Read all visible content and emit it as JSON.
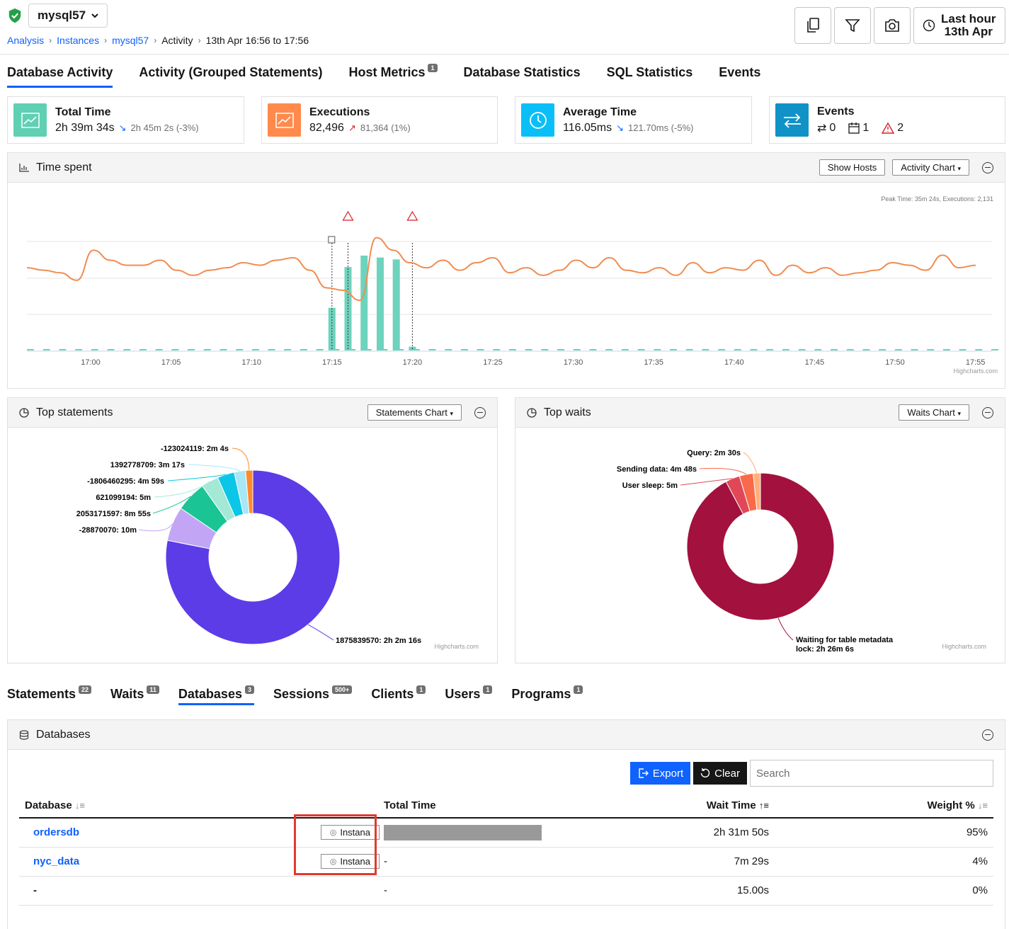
{
  "header": {
    "instance_name": "mysql57",
    "breadcrumb": [
      "Analysis",
      "Instances",
      "mysql57",
      "Activity",
      "13th Apr 16:56 to 17:56"
    ],
    "time_range_line1": "Last hour",
    "time_range_line2": "13th Apr"
  },
  "tabs": [
    {
      "label": "Database Activity",
      "active": true
    },
    {
      "label": "Activity (Grouped Statements)"
    },
    {
      "label": "Host Metrics",
      "badge": "1"
    },
    {
      "label": "Database Statistics"
    },
    {
      "label": "SQL Statistics"
    },
    {
      "label": "Events"
    }
  ],
  "kpis": {
    "total_time": {
      "title": "Total Time",
      "value": "2h 39m 34s",
      "compare": "2h 45m 2s (-3%)",
      "color": "#5fd0b3"
    },
    "executions": {
      "title": "Executions",
      "value": "82,496",
      "compare": "81,364 (1%)",
      "color": "#ff8a4c"
    },
    "average_time": {
      "title": "Average Time",
      "value": "116.05ms",
      "compare": "121.70ms (-5%)",
      "color": "#0abff7"
    },
    "events": {
      "title": "Events",
      "transfers": "0",
      "calendar": "1",
      "alerts": "2",
      "color": "#1192c7"
    }
  },
  "time_spent": {
    "title": "Time spent",
    "show_hosts": "Show Hosts",
    "chart_menu": "Activity Chart",
    "peak": "Peak Time: 35m 24s, Executions: 2,131",
    "credit": "Highcharts.com"
  },
  "top_statements": {
    "title": "Top statements",
    "chart_menu": "Statements Chart",
    "credit": "Highcharts.com"
  },
  "top_waits": {
    "title": "Top waits",
    "chart_menu": "Waits Chart",
    "credit": "Highcharts.com"
  },
  "chart_data": [
    {
      "type": "line",
      "title": "Time spent",
      "x_ticks": [
        "17:00",
        "17:05",
        "17:10",
        "17:15",
        "17:20",
        "17:25",
        "17:30",
        "17:35",
        "17:40",
        "17:45",
        "17:50",
        "17:55"
      ],
      "bars": [
        {
          "x": "17:15",
          "value": 0.45
        },
        {
          "x": "17:16",
          "value": 0.88
        },
        {
          "x": "17:17",
          "value": 1.0
        },
        {
          "x": "17:18",
          "value": 0.98
        },
        {
          "x": "17:19",
          "value": 0.96
        },
        {
          "x": "17:20",
          "value": 0.04
        }
      ],
      "bar_color": "#6dd3bd",
      "line_color": "#f08c51",
      "line_series": [
        0.66,
        0.64,
        0.62,
        0.56,
        0.8,
        0.72,
        0.68,
        0.68,
        0.72,
        0.64,
        0.6,
        0.64,
        0.66,
        0.7,
        0.68,
        0.72,
        0.74,
        0.64,
        0.5,
        0.48,
        0.4,
        0.9,
        0.8,
        0.7,
        0.66,
        0.72,
        0.64,
        0.7,
        0.74,
        0.62,
        0.66,
        0.6,
        0.64,
        0.72,
        0.66,
        0.74,
        0.64,
        0.62,
        0.66,
        0.6,
        0.7,
        0.62,
        0.66,
        0.64,
        0.72,
        0.6,
        0.68,
        0.62,
        0.66,
        0.6,
        0.62,
        0.64,
        0.7,
        0.68,
        0.64,
        0.76,
        0.66,
        0.68
      ],
      "markers": [
        "17:15",
        "17:16",
        "17:20"
      ]
    },
    {
      "type": "pie",
      "title": "Top statements",
      "labels": [
        "1875839570: 2h 2m 16s",
        "-28870070: 10m",
        "2053171597: 8m 55s",
        "621099194: 5m",
        "-1806460295: 4m 59s",
        "1392778709: 3m 17s",
        "-123024119: 2m 4s"
      ],
      "values": [
        7336,
        600,
        535,
        300,
        299,
        197,
        124
      ],
      "colors": [
        "#5c3ce6",
        "#c2a6f5",
        "#1bc495",
        "#a4e8d6",
        "#0cc6e8",
        "#a8e7f5",
        "#ff8a2a",
        "#e05a7e",
        "#ff4d4d"
      ]
    },
    {
      "type": "pie",
      "title": "Top waits",
      "labels": [
        "Waiting for table metadata lock: 2h 26m 6s",
        "User sleep: 5m",
        "Sending data: 4m 48s",
        "Query: 2m 30s"
      ],
      "values": [
        8766,
        300,
        288,
        150
      ],
      "colors": [
        "#a3113e",
        "#e04858",
        "#f86a4a",
        "#ffb079"
      ]
    }
  ],
  "subtabs": [
    {
      "label": "Statements",
      "badge": "22"
    },
    {
      "label": "Waits",
      "badge": "11"
    },
    {
      "label": "Databases",
      "badge": "3",
      "active": true
    },
    {
      "label": "Sessions",
      "badge": "500+"
    },
    {
      "label": "Clients",
      "badge": "1"
    },
    {
      "label": "Users",
      "badge": "1"
    },
    {
      "label": "Programs",
      "badge": "1"
    }
  ],
  "databases": {
    "title": "Databases",
    "export": "Export",
    "clear": "Clear",
    "search_placeholder": "Search",
    "columns": [
      "Database",
      "Total Time",
      "Wait Time",
      "Weight %"
    ],
    "rows": [
      {
        "name": "ordersdb",
        "badge": "Instana",
        "bar": 0.95,
        "wait": "2h 31m 50s",
        "weight": "95%"
      },
      {
        "name": "nyc_data",
        "badge": "Instana",
        "total": "-",
        "wait": "7m 29s",
        "weight": "4%"
      },
      {
        "name": "-",
        "total": "-",
        "wait": "15.00s",
        "weight": "0%"
      }
    ]
  }
}
